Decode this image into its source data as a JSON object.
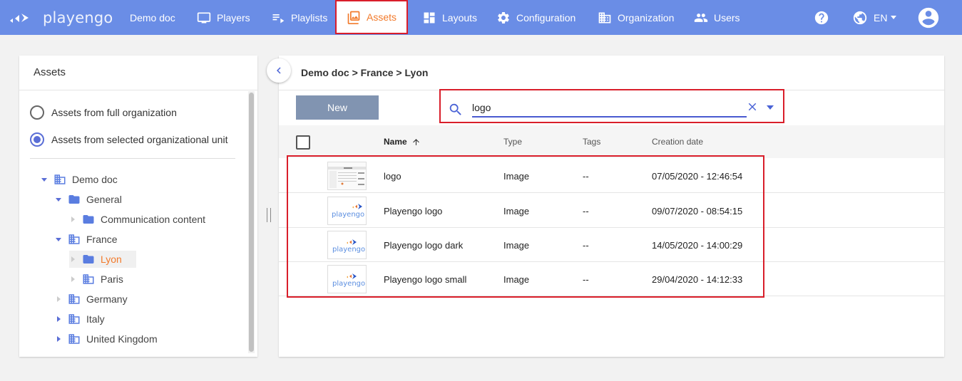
{
  "app": {
    "brand": "playengo",
    "nav": [
      {
        "label": "Demo doc",
        "icon": "none"
      },
      {
        "label": "Players",
        "icon": "monitor-icon"
      },
      {
        "label": "Playlists",
        "icon": "playlist-icon"
      },
      {
        "label": "Assets",
        "icon": "image-icon",
        "active": true
      },
      {
        "label": "Layouts",
        "icon": "layout-icon"
      },
      {
        "label": "Configuration",
        "icon": "gear-icon"
      },
      {
        "label": "Organization",
        "icon": "building-icon"
      },
      {
        "label": "Users",
        "icon": "people-icon"
      }
    ],
    "language": "EN"
  },
  "left_panel": {
    "title": "Assets",
    "radio_options": [
      {
        "label": "Assets from full organization",
        "checked": false
      },
      {
        "label": "Assets from selected organizational unit",
        "checked": true
      }
    ],
    "tree": [
      {
        "label": "Demo doc",
        "icon": "building-icon",
        "state": "expanded"
      },
      {
        "label": "General",
        "icon": "folder-icon",
        "state": "expanded"
      },
      {
        "label": "Communication content",
        "icon": "folder-icon",
        "state": "leaf"
      },
      {
        "label": "France",
        "icon": "building-icon",
        "state": "expanded"
      },
      {
        "label": "Lyon",
        "icon": "folder-icon",
        "state": "leaf",
        "selected": true
      },
      {
        "label": "Paris",
        "icon": "building-icon",
        "state": "leaf"
      },
      {
        "label": "Germany",
        "icon": "building-icon",
        "state": "collapsed"
      },
      {
        "label": "Italy",
        "icon": "building-icon",
        "state": "collapsed"
      },
      {
        "label": "United Kingdom",
        "icon": "building-icon",
        "state": "collapsed"
      }
    ]
  },
  "right_panel": {
    "breadcrumb": "Demo doc > France > Lyon",
    "new_button": "New",
    "search": {
      "value": "logo"
    },
    "columns": {
      "name": "Name",
      "type": "Type",
      "tags": "Tags",
      "created": "Creation date"
    },
    "rows": [
      {
        "name": "logo",
        "type": "Image",
        "tags": "--",
        "created": "07/05/2020 - 12:46:54",
        "thumb": "screenshot"
      },
      {
        "name": "Playengo logo",
        "type": "Image",
        "tags": "--",
        "created": "09/07/2020 - 08:54:15",
        "thumb": "playengo"
      },
      {
        "name": "Playengo logo dark",
        "type": "Image",
        "tags": "--",
        "created": "14/05/2020 - 14:00:29",
        "thumb": "playengo"
      },
      {
        "name": "Playengo logo small",
        "type": "Image",
        "tags": "--",
        "created": "29/04/2020 - 14:12:33",
        "thumb": "playengo"
      }
    ]
  },
  "colors": {
    "topbar": "#6a8de6",
    "accent": "#f27a2b",
    "highlight": "#d91e2a",
    "primary": "#4a63d6"
  }
}
